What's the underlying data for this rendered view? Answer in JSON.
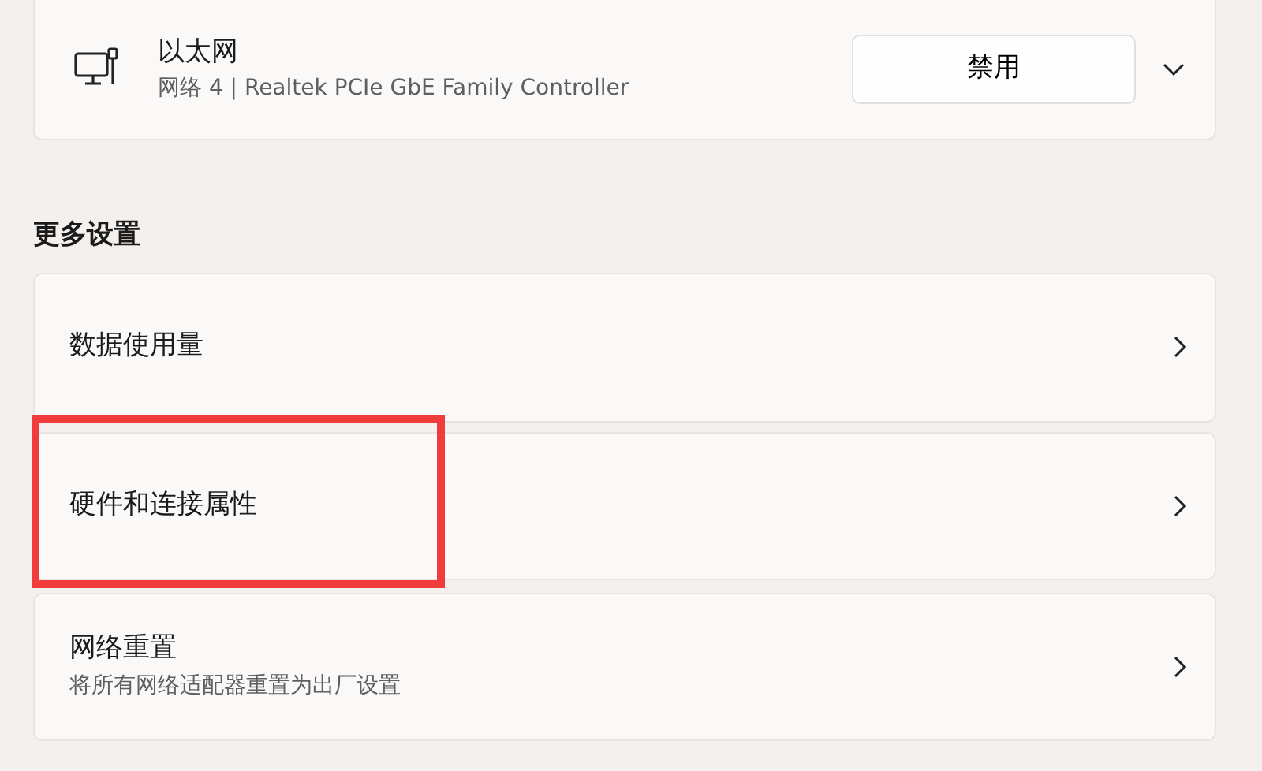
{
  "adapter": {
    "name": "以太网",
    "description": "网络 4 | Realtek PCIe GbE Family Controller",
    "button": "禁用",
    "expanded": false
  },
  "section_title": "更多设置",
  "items": [
    {
      "title": "数据使用量",
      "highlighted": false
    },
    {
      "title": "硬件和连接属性",
      "highlighted": true
    },
    {
      "title": "网络重置",
      "subtitle": "将所有网络适配器重置为出厂设置",
      "highlighted": false
    }
  ]
}
